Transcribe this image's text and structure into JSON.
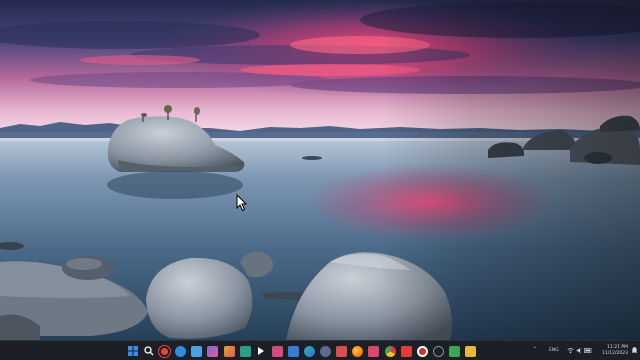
{
  "wallpaper": {
    "description_colors": {
      "sky_top": "#2a3158",
      "sky_glow": "#e0467a",
      "horizon": "#f4c9dc",
      "water": "#4a6b8a",
      "rock": "#9aa3ad"
    }
  },
  "taskbar": {
    "background": "#1c1f26",
    "pinned": [
      {
        "name": "start-button",
        "icon": "windows-logo-icon",
        "color": "#3a8ee6"
      },
      {
        "name": "search-button",
        "icon": "search-icon",
        "color": "#ffffff"
      },
      {
        "name": "app-1",
        "icon": "circle-red-icon",
        "color": "#e8463b"
      },
      {
        "name": "app-2",
        "icon": "circle-blue-icon",
        "color": "#2f8de4"
      },
      {
        "name": "app-3",
        "icon": "file-explorer-icon",
        "color": "#4aa3df"
      },
      {
        "name": "app-4",
        "icon": "widgets-icon",
        "color": "#7d6bd8"
      },
      {
        "name": "app-5",
        "icon": "photos-icon",
        "color": "#e3a32a"
      },
      {
        "name": "app-6",
        "icon": "terminal-icon",
        "color": "#2a9d8f"
      },
      {
        "name": "app-7",
        "icon": "arrow-app-icon",
        "color": "#ffffff"
      },
      {
        "name": "app-8",
        "icon": "mail-icon",
        "color": "#d84a7a"
      },
      {
        "name": "app-9",
        "icon": "store-icon",
        "color": "#3a7bd5"
      },
      {
        "name": "app-10",
        "icon": "edge-browser-icon",
        "color": "#2bb3a8"
      },
      {
        "name": "app-11",
        "icon": "settings-icon",
        "color": "#5a6b8c"
      },
      {
        "name": "app-12",
        "icon": "media-icon",
        "color": "#d94f4f"
      },
      {
        "name": "app-13",
        "icon": "firefox-icon",
        "color": "#ff7a1a"
      },
      {
        "name": "app-14",
        "icon": "paint-icon",
        "color": "#e0466a"
      },
      {
        "name": "app-15",
        "icon": "chrome-icon",
        "color": "#f2c230"
      },
      {
        "name": "app-16",
        "icon": "video-app-icon",
        "color": "#e23b3b"
      },
      {
        "name": "app-17",
        "icon": "recorder-icon",
        "color": "#c93030"
      },
      {
        "name": "app-18",
        "icon": "clock-app-icon",
        "color": "#8a9099"
      },
      {
        "name": "app-19",
        "icon": "notepad-icon",
        "color": "#3aa853"
      },
      {
        "name": "app-20",
        "icon": "folder-icon",
        "color": "#e8b83a"
      }
    ],
    "tray": {
      "chevron": "^",
      "language": "ENG",
      "time": "11:21 PM",
      "date": "11/12/2023"
    }
  }
}
